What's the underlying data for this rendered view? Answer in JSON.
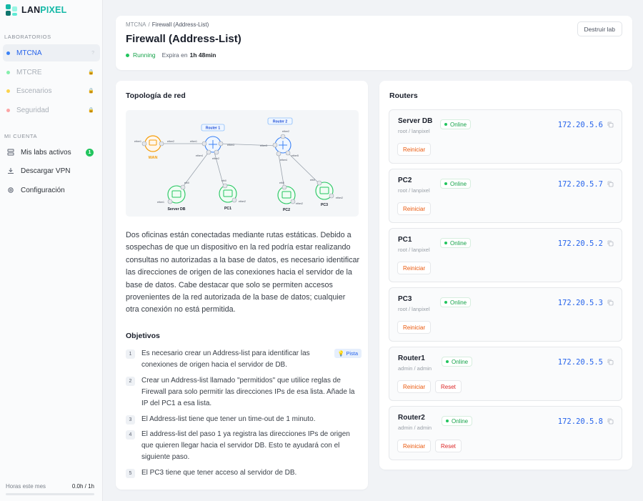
{
  "app": {
    "logo_a": "LAN",
    "logo_b": "PIXEL"
  },
  "sidebar": {
    "labs_label": "LABORATORIOS",
    "labs": [
      {
        "label": "MTCNA",
        "color": "#3b82f6",
        "active": true,
        "trail": "?"
      },
      {
        "label": "MTCRE",
        "color": "#86efac",
        "active": false,
        "trail": "🔒"
      },
      {
        "label": "Escenarios",
        "color": "#fcd34d",
        "active": false,
        "trail": "🔒"
      },
      {
        "label": "Seguridad",
        "color": "#fca5a5",
        "active": false,
        "trail": "🔒"
      }
    ],
    "account_label": "MI CUENTA",
    "account": [
      {
        "label": "Mis labs activos",
        "icon": "server-icon",
        "badge": "1"
      },
      {
        "label": "Descargar VPN",
        "icon": "download-icon",
        "badge": ""
      },
      {
        "label": "Configuración",
        "icon": "gear-icon",
        "badge": ""
      }
    ],
    "hours_label": "Horas este mes",
    "hours_value": "0.0h / 1h"
  },
  "header": {
    "breadcrumb_root": "MTCNA",
    "breadcrumb_sep": "/",
    "breadcrumb_current": "Firewall (Address-List)",
    "title": "Firewall (Address-List)",
    "status": "Running",
    "expira_label": "Expira en",
    "expira_value": "1h 48min",
    "destroy_label": "Destruir lab"
  },
  "topology": {
    "title": "Topología de red",
    "router1": "Router 1",
    "router2": "Router 2",
    "wan": "WAN",
    "server_db": "Server DB",
    "pc1": "PC1",
    "pc2": "PC2",
    "pc3": "PC3",
    "ether1": "ether1",
    "ether2": "ether2",
    "ether3": "ether3",
    "ether4": "ether4",
    "ether5": "ether5",
    "eth0": "eth0"
  },
  "description": "Dos oficinas están conectadas mediante rutas estáticas. Debido a sospechas de que un dispositivo en la red podría estar realizando consultas no autorizadas a la base de datos, es necesario identificar las direcciones de origen de las conexiones hacia el servidor de la base de datos. Cabe destacar que solo se permiten accesos provenientes de la red autorizada de la base de datos; cualquier otra conexión no está permitida.",
  "objectives": {
    "title": "Objetivos",
    "hint": "💡 Pista",
    "items": [
      {
        "num": "1",
        "text": "Es necesario crear un Address-list para identificar las conexiones de origen hacia el servidor de DB."
      },
      {
        "num": "2",
        "text": "Crear un Address-list llamado \"permitidos\" que utilice reglas de Firewall para solo permitir las direcciones IPs de esa lista. Añade la IP del PC1 a esa lista."
      },
      {
        "num": "3",
        "text": "El Address-list tiene que tener un time-out de 1 minuto."
      },
      {
        "num": "4",
        "text": "El address-list del paso 1 ya registra las direcciones IPs de origen que quieren llegar hacia el servidor DB. Esto te ayudará con el siguiente paso."
      },
      {
        "num": "5",
        "text": "El PC3 tiene que tener acceso al servidor de DB."
      }
    ]
  },
  "routers": {
    "title": "Routers",
    "online_label": "Online",
    "restart_label": "Reiniciar",
    "reset_label": "Reset",
    "items": [
      {
        "name": "Server DB",
        "cred": "root / lanpixel",
        "ip": "172.20.5.6",
        "reset": false
      },
      {
        "name": "PC2",
        "cred": "root / lanpixel",
        "ip": "172.20.5.7",
        "reset": false
      },
      {
        "name": "PC1",
        "cred": "root / lanpixel",
        "ip": "172.20.5.2",
        "reset": false
      },
      {
        "name": "PC3",
        "cred": "root / lanpixel",
        "ip": "172.20.5.3",
        "reset": false
      },
      {
        "name": "Router1",
        "cred": "admin / admin",
        "ip": "172.20.5.5",
        "reset": true
      },
      {
        "name": "Router2",
        "cred": "admin / admin",
        "ip": "172.20.5.8",
        "reset": true
      }
    ]
  }
}
